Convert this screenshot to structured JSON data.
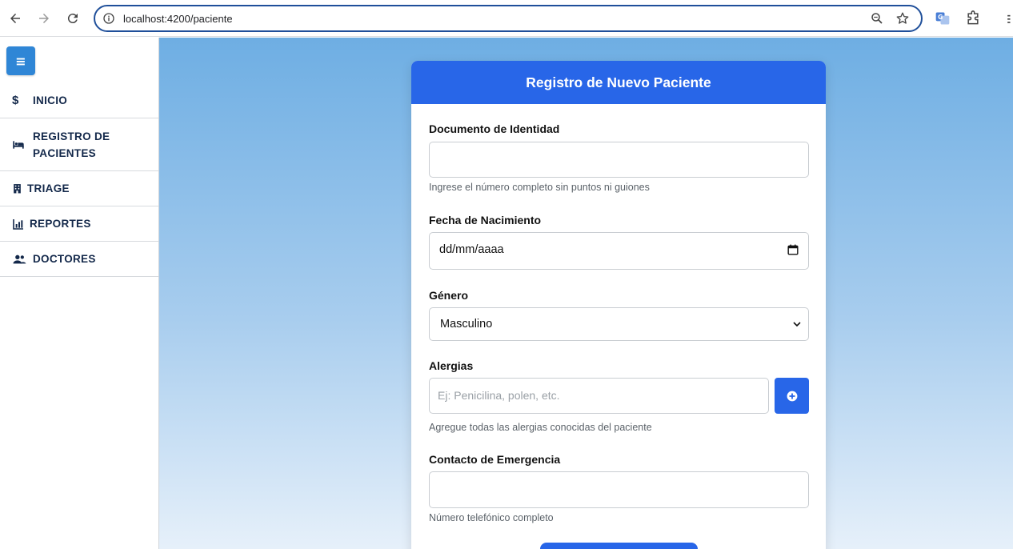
{
  "browser": {
    "url": "localhost:4200/paciente"
  },
  "sidebar": {
    "toggle_icon": "hamburger-icon",
    "items": [
      {
        "label": "INICIO",
        "icon": "dollar-icon"
      },
      {
        "label_line1": "REGISTRO DE",
        "label_line2": "PACIENTES",
        "icon": "bed-icon"
      },
      {
        "label": "TRIAGE",
        "icon": "building-icon"
      },
      {
        "label": "REPORTES",
        "icon": "chart-icon"
      },
      {
        "label": "DOCTORES",
        "icon": "users-icon"
      }
    ]
  },
  "form": {
    "title": "Registro de Nuevo Paciente",
    "documento": {
      "label": "Documento de Identidad",
      "value": "",
      "hint": "Ingrese el número completo sin puntos ni guiones"
    },
    "fecha": {
      "label": "Fecha de Nacimiento",
      "value": "dd/mm/aaaa"
    },
    "genero": {
      "label": "Género",
      "selected": "Masculino"
    },
    "alergias": {
      "label": "Alergias",
      "placeholder": "Ej: Penicilina, polen, etc.",
      "hint": "Agregue todas las alergias conocidas del paciente"
    },
    "contacto": {
      "label": "Contacto de Emergencia",
      "value": "",
      "hint": "Número telefónico completo"
    }
  },
  "colors": {
    "primary": "#2866e8",
    "sidebar_text": "#13284a",
    "toggle": "#2f86d6"
  }
}
